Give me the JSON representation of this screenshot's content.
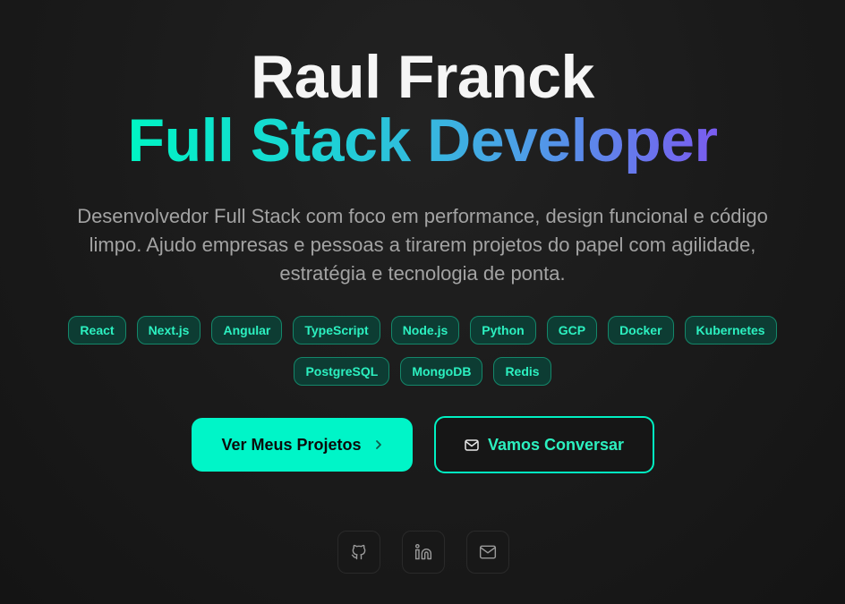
{
  "hero": {
    "name": "Raul Franck",
    "role": "Full Stack Developer",
    "description": "Desenvolvedor Full Stack com foco em performance, design funcional e código limpo. Ajudo empresas e pessoas a tirarem projetos do papel com agilidade, estratégia e tecnologia de ponta."
  },
  "tags": [
    "React",
    "Next.js",
    "Angular",
    "TypeScript",
    "Node.js",
    "Python",
    "GCP",
    "Docker",
    "Kubernetes",
    "PostgreSQL",
    "MongoDB",
    "Redis"
  ],
  "buttons": {
    "projects_label": "Ver Meus Projetos",
    "projects_icon": "chevron-right-icon",
    "contact_label": "Vamos Conversar",
    "contact_icon": "mail-icon"
  },
  "social": [
    {
      "icon": "github-icon"
    },
    {
      "icon": "linkedin-icon"
    },
    {
      "icon": "mail-icon"
    }
  ],
  "colors": {
    "background": "#1a1a1a",
    "accent": "#00f5c8",
    "gradient_start": "#00f5c4",
    "gradient_end": "#7a5cf0",
    "tag_text": "#2cf0c0",
    "tag_bg": "#0d3c33",
    "muted_text": "#a3a3a3"
  }
}
